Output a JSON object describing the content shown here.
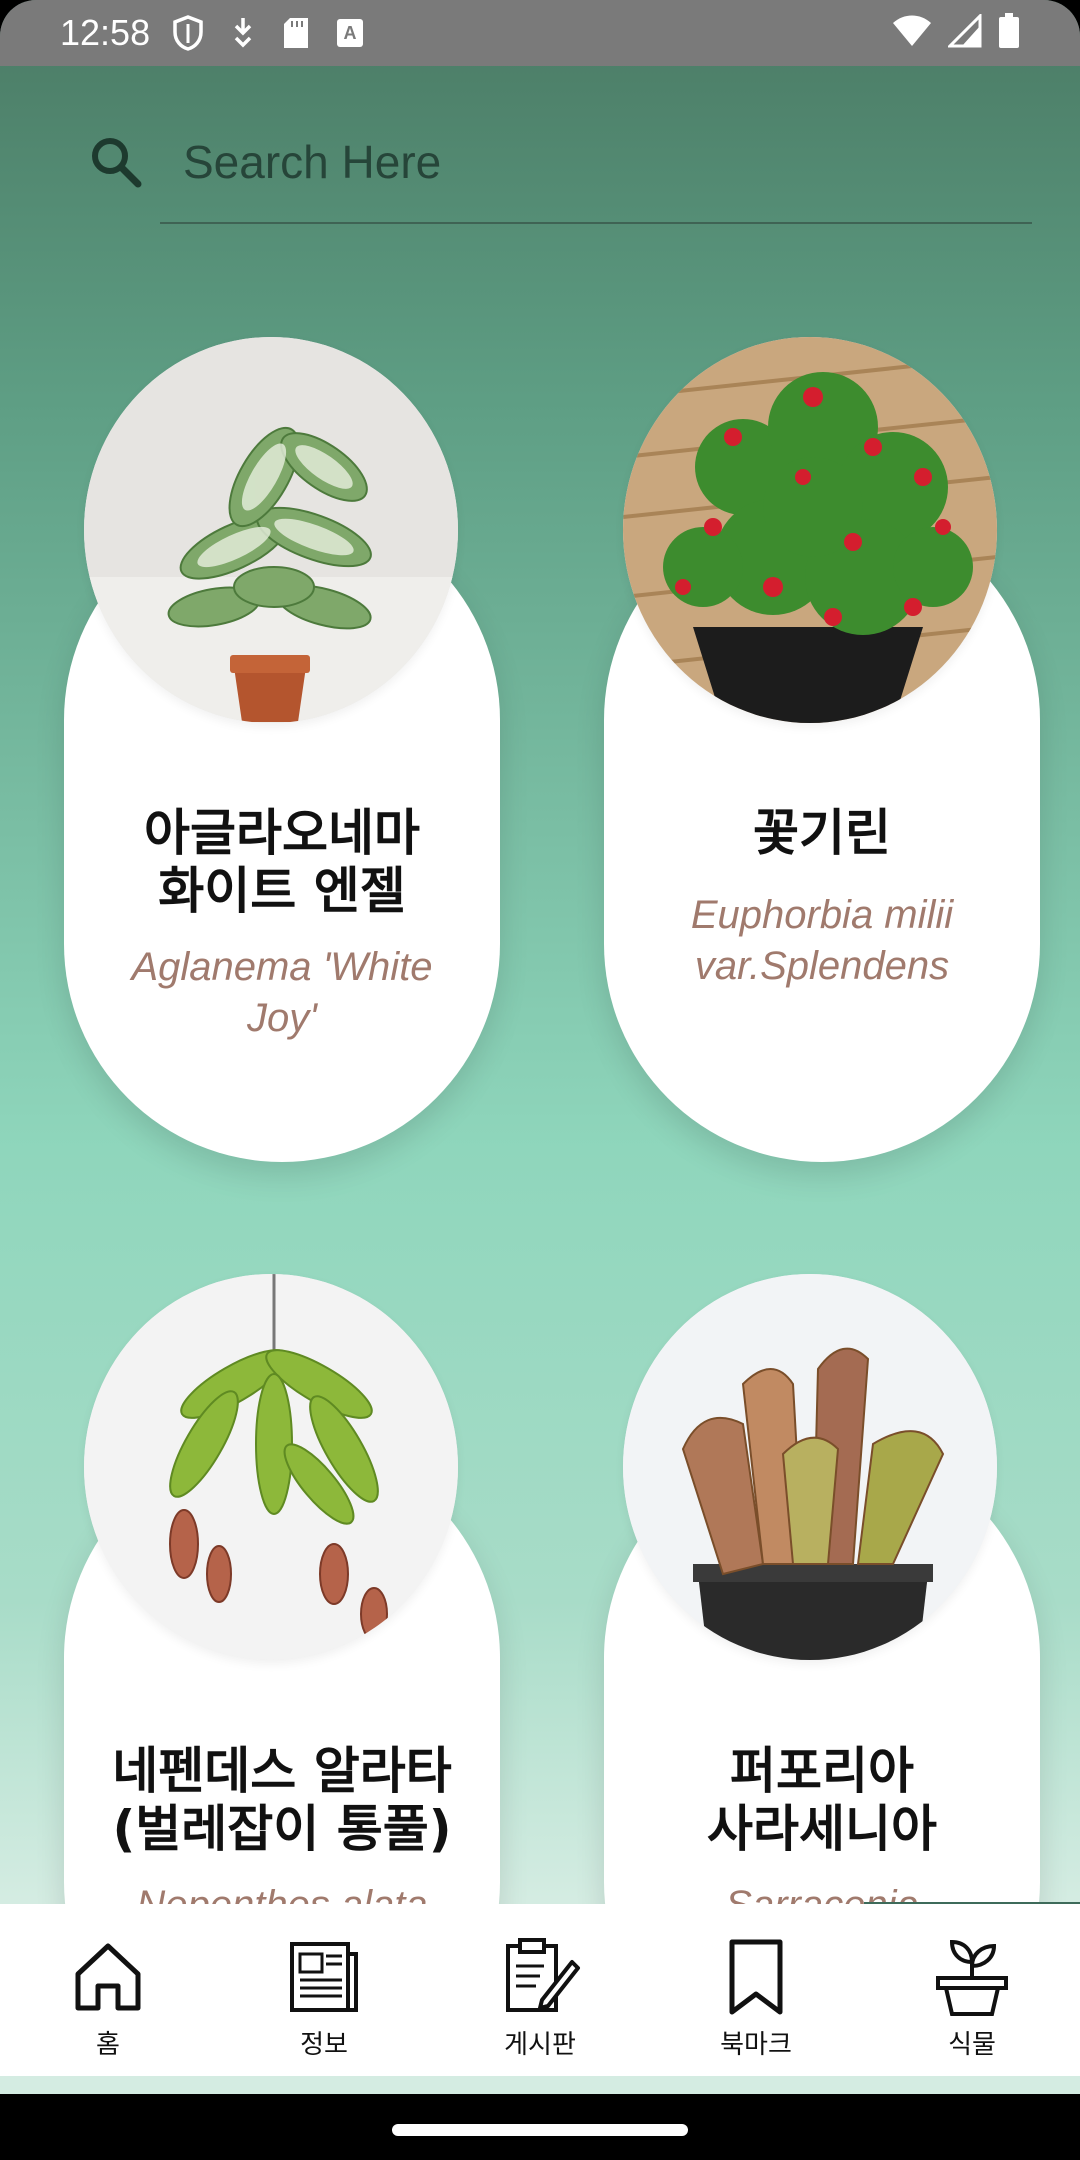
{
  "status_bar": {
    "time": "12:58"
  },
  "search": {
    "placeholder": "Search Here",
    "value": ""
  },
  "plants": [
    {
      "name": "아글라오네마\n화이트 엔젤",
      "scientific": "Aglanema 'White Joy'",
      "image": "potted-aglaonema-photo"
    },
    {
      "name": "꽃기린",
      "scientific": "Euphorbia milii var.Splendens",
      "image": "crown-of-thorns-photo"
    },
    {
      "name": "네펜데스 알라타\n(벌레잡이 통풀)",
      "scientific": "Nepenthes alata",
      "image": "hanging-pitcher-plant-photo"
    },
    {
      "name": "퍼포리아\n사라세니아",
      "scientific": "Sarracenia purpurea",
      "image": "sarracenia-pot-photo"
    }
  ],
  "nav": {
    "items": [
      {
        "label": "홈",
        "icon": "home-icon"
      },
      {
        "label": "정보",
        "icon": "newspaper-icon"
      },
      {
        "label": "게시판",
        "icon": "clipboard-pen-icon"
      },
      {
        "label": "북마크",
        "icon": "bookmark-icon"
      },
      {
        "label": "식물",
        "icon": "plant-pot-icon"
      }
    ]
  },
  "colors": {
    "accent": "#3e6b5a",
    "scientific_text": "#a07a6d"
  }
}
